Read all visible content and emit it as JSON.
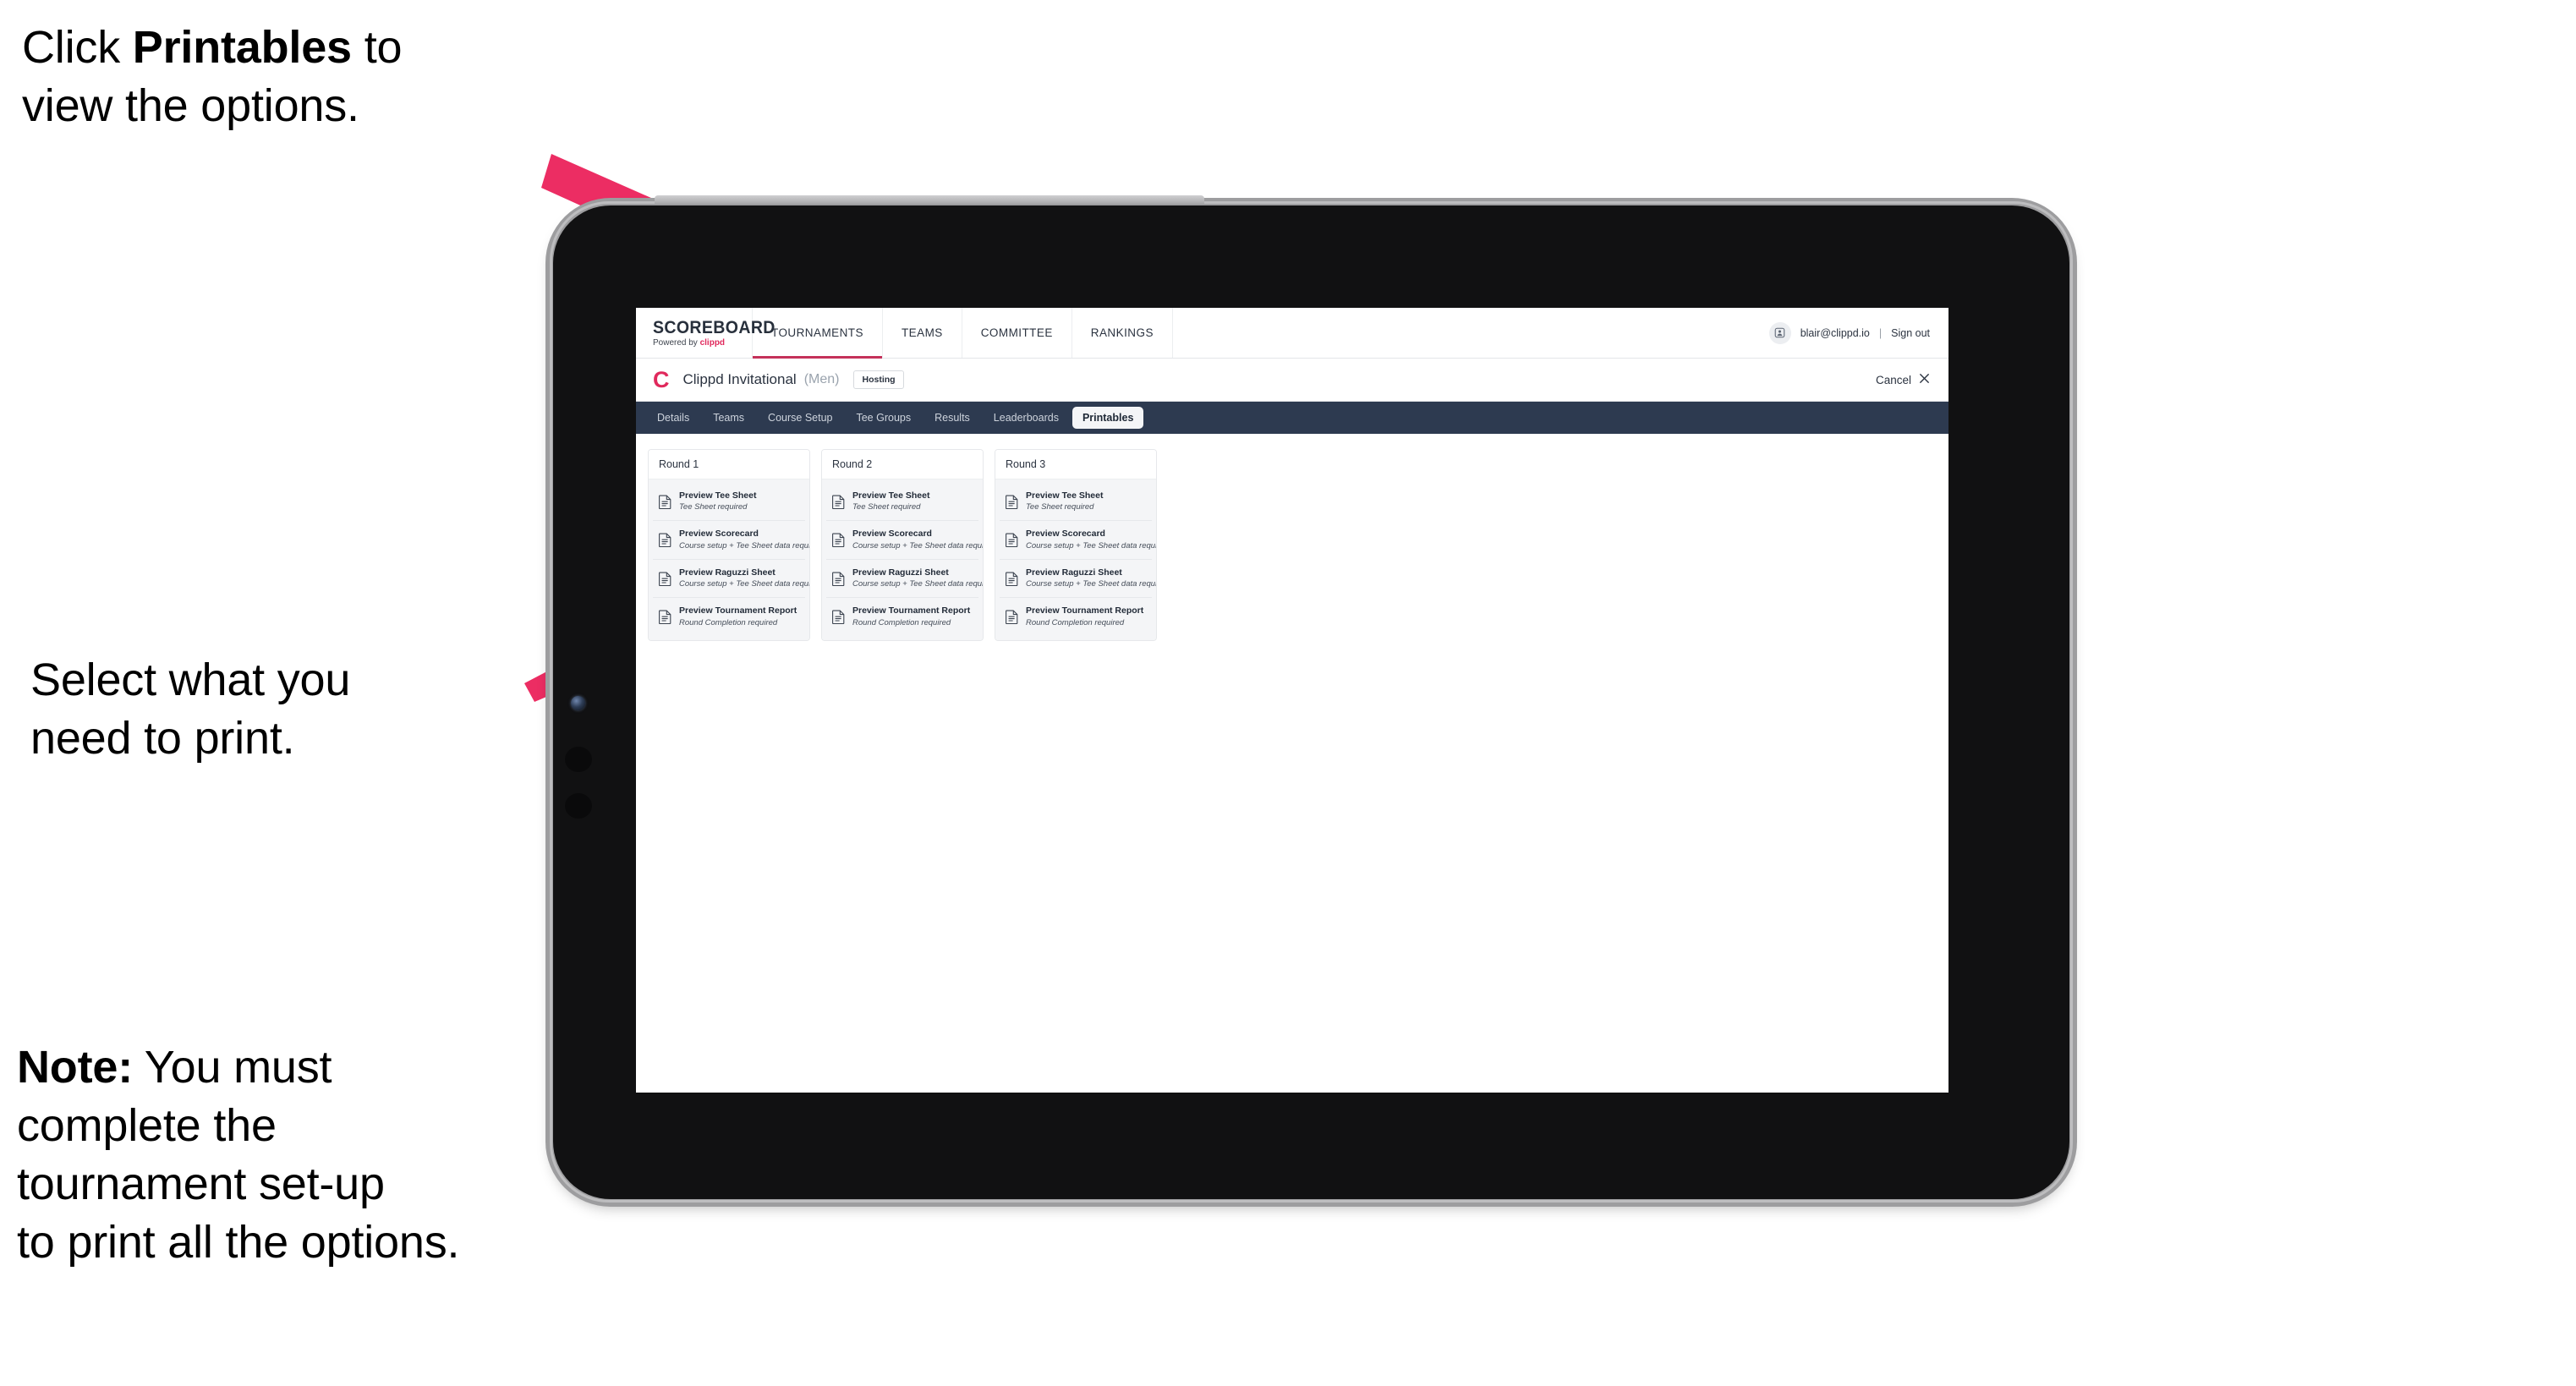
{
  "annotations": [
    {
      "id": "annot-1",
      "prefix": "Click ",
      "bold": "Printables",
      "suffix": " to\nview the options."
    },
    {
      "id": "annot-2",
      "text": "Select what you\n need to print."
    },
    {
      "id": "annot-3",
      "prefix": "",
      "bold": "Note:",
      "suffix": " You must\ncomplete the\ntournament set-up\nto print all the options."
    }
  ],
  "colors": {
    "accent_pink": "#e0295c",
    "arrow_pink": "#ec2d63",
    "tab_strip": "#2d3a50",
    "active_underline": "#c4315a",
    "card_bg": "#f4f5f7"
  },
  "app": {
    "brand": {
      "title": "SCOREBOARD",
      "powered_prefix": "Powered by ",
      "powered_name": "clippd"
    },
    "topnav": [
      {
        "label": "TOURNAMENTS",
        "active": true
      },
      {
        "label": "TEAMS",
        "active": false
      },
      {
        "label": "COMMITTEE",
        "active": false
      },
      {
        "label": "RANKINGS",
        "active": false
      }
    ],
    "account": {
      "avatar_icon": "user-avatar-icon",
      "email": "blair@clippd.io",
      "separator": "|",
      "sign_out": "Sign out"
    },
    "titlebar": {
      "logo_mark": "C",
      "tournament_name": "Clippd Invitational",
      "gender": "(Men)",
      "status_badge": "Hosting",
      "cancel_label": "Cancel",
      "cancel_icon": "close-x-icon"
    },
    "tabs": [
      {
        "label": "Details",
        "active": false
      },
      {
        "label": "Teams",
        "active": false
      },
      {
        "label": "Course Setup",
        "active": false
      },
      {
        "label": "Tee Groups",
        "active": false
      },
      {
        "label": "Results",
        "active": false
      },
      {
        "label": "Leaderboards",
        "active": false
      },
      {
        "label": "Printables",
        "active": true
      }
    ],
    "rounds": [
      {
        "header": "Round 1",
        "items": [
          {
            "icon": "document-icon",
            "title": "Preview Tee Sheet",
            "subtitle": "Tee Sheet required"
          },
          {
            "icon": "document-icon",
            "title": "Preview Scorecard",
            "subtitle": "Course setup + Tee Sheet data required"
          },
          {
            "icon": "document-icon",
            "title": "Preview Raguzzi Sheet",
            "subtitle": "Course setup + Tee Sheet data required"
          },
          {
            "icon": "document-icon",
            "title": "Preview Tournament Report",
            "subtitle": "Round Completion required"
          }
        ]
      },
      {
        "header": "Round 2",
        "items": [
          {
            "icon": "document-icon",
            "title": "Preview Tee Sheet",
            "subtitle": "Tee Sheet required"
          },
          {
            "icon": "document-icon",
            "title": "Preview Scorecard",
            "subtitle": "Course setup + Tee Sheet data required"
          },
          {
            "icon": "document-icon",
            "title": "Preview Raguzzi Sheet",
            "subtitle": "Course setup + Tee Sheet data required"
          },
          {
            "icon": "document-icon",
            "title": "Preview Tournament Report",
            "subtitle": "Round Completion required"
          }
        ]
      },
      {
        "header": "Round 3",
        "items": [
          {
            "icon": "document-icon",
            "title": "Preview Tee Sheet",
            "subtitle": "Tee Sheet required"
          },
          {
            "icon": "document-icon",
            "title": "Preview Scorecard",
            "subtitle": "Course setup + Tee Sheet data required"
          },
          {
            "icon": "document-icon",
            "title": "Preview Raguzzi Sheet",
            "subtitle": "Course setup + Tee Sheet data required"
          },
          {
            "icon": "document-icon",
            "title": "Preview Tournament Report",
            "subtitle": "Round Completion required"
          }
        ]
      }
    ]
  }
}
